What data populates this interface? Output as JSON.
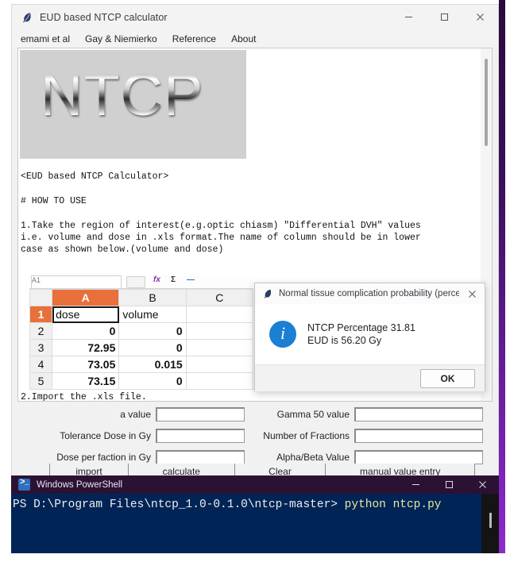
{
  "app": {
    "title": "EUD based NTCP calculator",
    "icon": "feather-icon",
    "window_controls": {
      "minimize": "minimize-icon",
      "maximize": "maximize-icon",
      "close": "close-icon"
    },
    "menu": [
      {
        "label": "emami et al"
      },
      {
        "label": "Gay & Niemierko"
      },
      {
        "label": "Reference"
      },
      {
        "label": "About"
      }
    ]
  },
  "content": {
    "logo_text": "NTCP",
    "heading": "<EUD based NTCP Calculator>",
    "howto_title": "# HOW TO USE",
    "step1_line1": "1.Take the region of interest(e.g.optic chiasm) \"Differential DVH\" values",
    "step1_line2": "i.e. volume and dose in .xls format.The name of column should be in lower",
    "step1_line3": "case as shown below.(volume and dose)",
    "step2": "2.Import the .xls file."
  },
  "sheet": {
    "namebox_value": "A1",
    "tool_fx": "fx",
    "tool_sigma": "Σ",
    "tool_dash": "—",
    "columns": [
      "",
      "A",
      "B",
      "C"
    ],
    "selected_column": "A",
    "selected_row": "1",
    "rows": [
      {
        "n": "1",
        "a": "dose",
        "b": "volume",
        "c": "",
        "type": "text"
      },
      {
        "n": "2",
        "a": "0",
        "b": "0",
        "c": "",
        "type": "num"
      },
      {
        "n": "3",
        "a": "72.95",
        "b": "0",
        "c": "",
        "type": "num"
      },
      {
        "n": "4",
        "a": "73.05",
        "b": "0.015",
        "c": "",
        "type": "num"
      },
      {
        "n": "5",
        "a": "73.15",
        "b": "0",
        "c": "",
        "type": "num"
      }
    ]
  },
  "dialog": {
    "title": "Normal tissue complication probability (percen...",
    "icon": "feather-icon",
    "close_icon": "close-icon",
    "info_icon": "info-icon",
    "message_line1": "NTCP Percentage 31.81",
    "message_line2": "EUD is 56.20 Gy",
    "ok_label": "OK",
    "accent_color": "#1b7fd4"
  },
  "form": {
    "fields": [
      {
        "label": "a value",
        "value": "",
        "placeholder": ""
      },
      {
        "label": "Gamma 50 value",
        "value": "",
        "placeholder": ""
      },
      {
        "label": "Tolerance Dose in Gy",
        "value": "",
        "placeholder": ""
      },
      {
        "label": "Number of Fractions",
        "value": "",
        "placeholder": ""
      },
      {
        "label": "Dose per faction in Gy",
        "value": "",
        "placeholder": ""
      },
      {
        "label": "Alpha/Beta Value",
        "value": "",
        "placeholder": ""
      }
    ],
    "buttons": [
      {
        "label": "import"
      },
      {
        "label": "calculate"
      },
      {
        "label": "Clear"
      },
      {
        "label": "manual value entry"
      }
    ]
  },
  "powershell": {
    "title": "Windows PowerShell",
    "icon": "powershell-icon",
    "window_controls": {
      "minimize": "minimize-icon",
      "maximize": "maximize-icon",
      "close": "close-icon"
    },
    "prompt": "PS D:\\Program Files\\ntcp_1.0-0.1.0\\ntcp-master> ",
    "command": "python ntcp.py",
    "background_color": "#012456",
    "titlebar_color": "#2b1234"
  }
}
